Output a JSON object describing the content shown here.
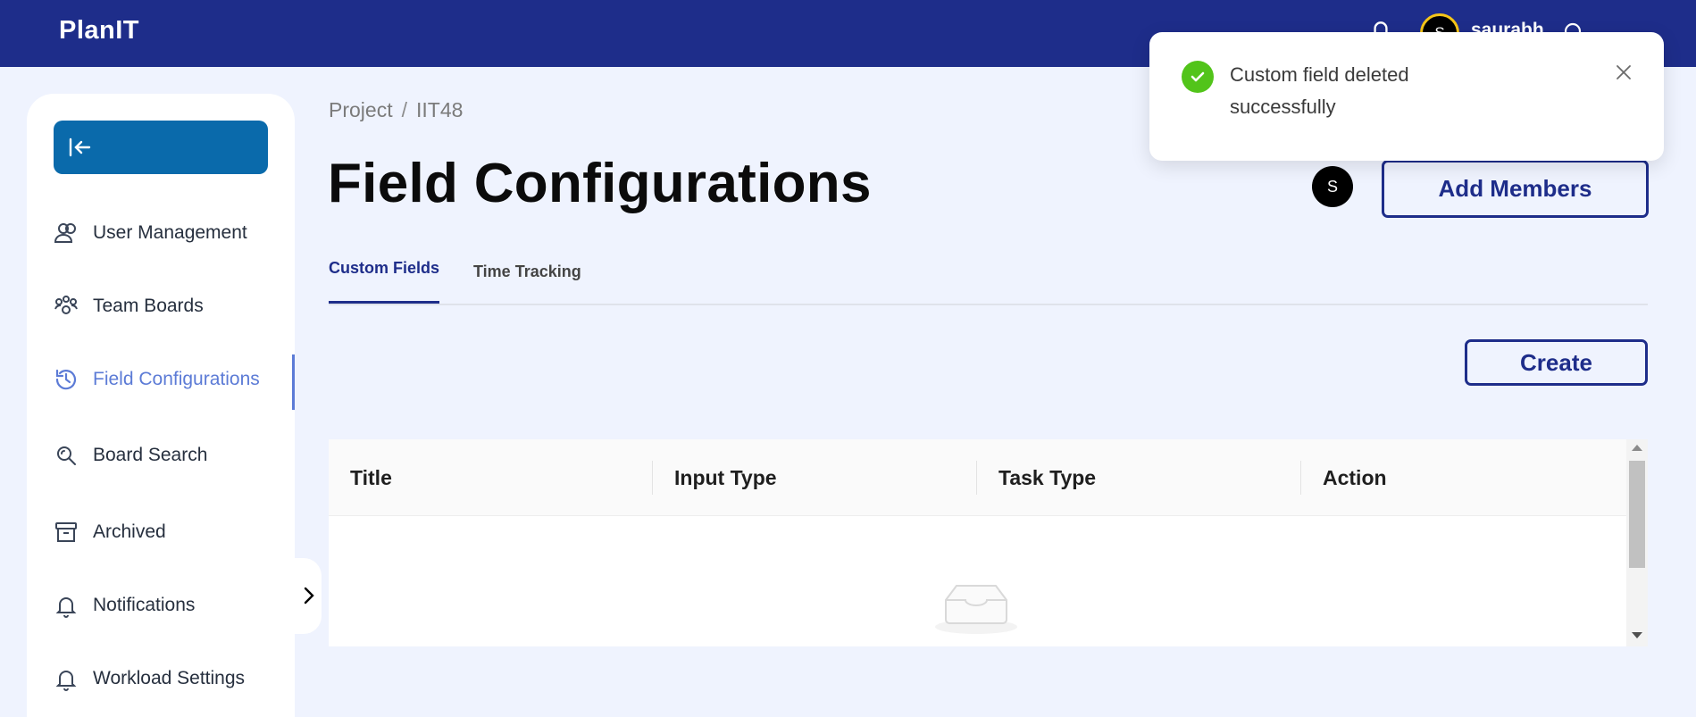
{
  "app": {
    "brand": "PlanIT"
  },
  "topbar": {
    "avatar_initial": "S",
    "username": "saurabh"
  },
  "sidebar": {
    "items": [
      {
        "label": "User Management",
        "icon": "users-icon"
      },
      {
        "label": "Team Boards",
        "icon": "team-icon"
      },
      {
        "label": "Field Configurations",
        "icon": "history-icon",
        "active": true
      },
      {
        "label": "Board Search",
        "icon": "search-icon"
      },
      {
        "label": "Archived",
        "icon": "archive-icon"
      },
      {
        "label": "Notifications",
        "icon": "bell-icon"
      },
      {
        "label": "Workload Settings",
        "icon": "bell-icon"
      }
    ]
  },
  "breadcrumb": {
    "root": "Project",
    "separator": "/",
    "current": "IIT48"
  },
  "page": {
    "title": "Field Configurations",
    "member_initial": "S",
    "add_members_label": "Add Members",
    "create_label": "Create"
  },
  "tabs": [
    {
      "label": "Custom Fields",
      "active": true
    },
    {
      "label": "Time Tracking",
      "active": false
    }
  ],
  "table": {
    "columns": [
      "Title",
      "Input Type",
      "Task Type",
      "Action"
    ],
    "rows": []
  },
  "toast": {
    "message": "Custom field deleted successfully",
    "status": "success"
  },
  "colors": {
    "primary": "#1e2d8a",
    "collapse_button": "#0a6aab",
    "active_nav": "#5c7bd6",
    "success": "#52c41a",
    "background": "#eff3fe"
  }
}
